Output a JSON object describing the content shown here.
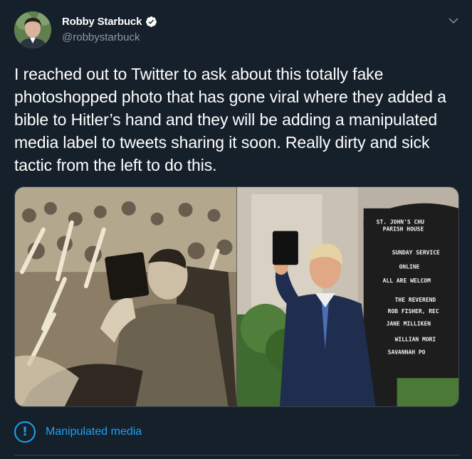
{
  "author": {
    "name": "Robby Starbuck",
    "handle": "@robbystarbuck",
    "avatar_icon": "profile-photo",
    "verified_icon": "verified-badge-icon"
  },
  "tweet": {
    "text": "I reached out to Twitter to ask about this totally fake photoshopped photo that has gone viral where they added a bible to Hitler’s hand and they will be adding a manipulated media label to tweets sharing it soon. Really dirty and sick tactic from the left to do this."
  },
  "media": {
    "sign_lines": [
      "ST. JOHN'S CHU",
      "PARISH HOUSE",
      "SUNDAY SERVICE",
      "ONLINE",
      "ALL ARE WELCOM",
      "THE REVEREND",
      "ROB FISHER, REC",
      "JANE MILLIKEN",
      "WILLIAN MORI",
      "SAVANNAH PO"
    ]
  },
  "label": {
    "icon": "exclamation-circle-icon",
    "text": "Manipulated media"
  },
  "colors": {
    "background": "#15202b",
    "accent": "#1da1f2",
    "secondary_text": "#8899a6"
  }
}
